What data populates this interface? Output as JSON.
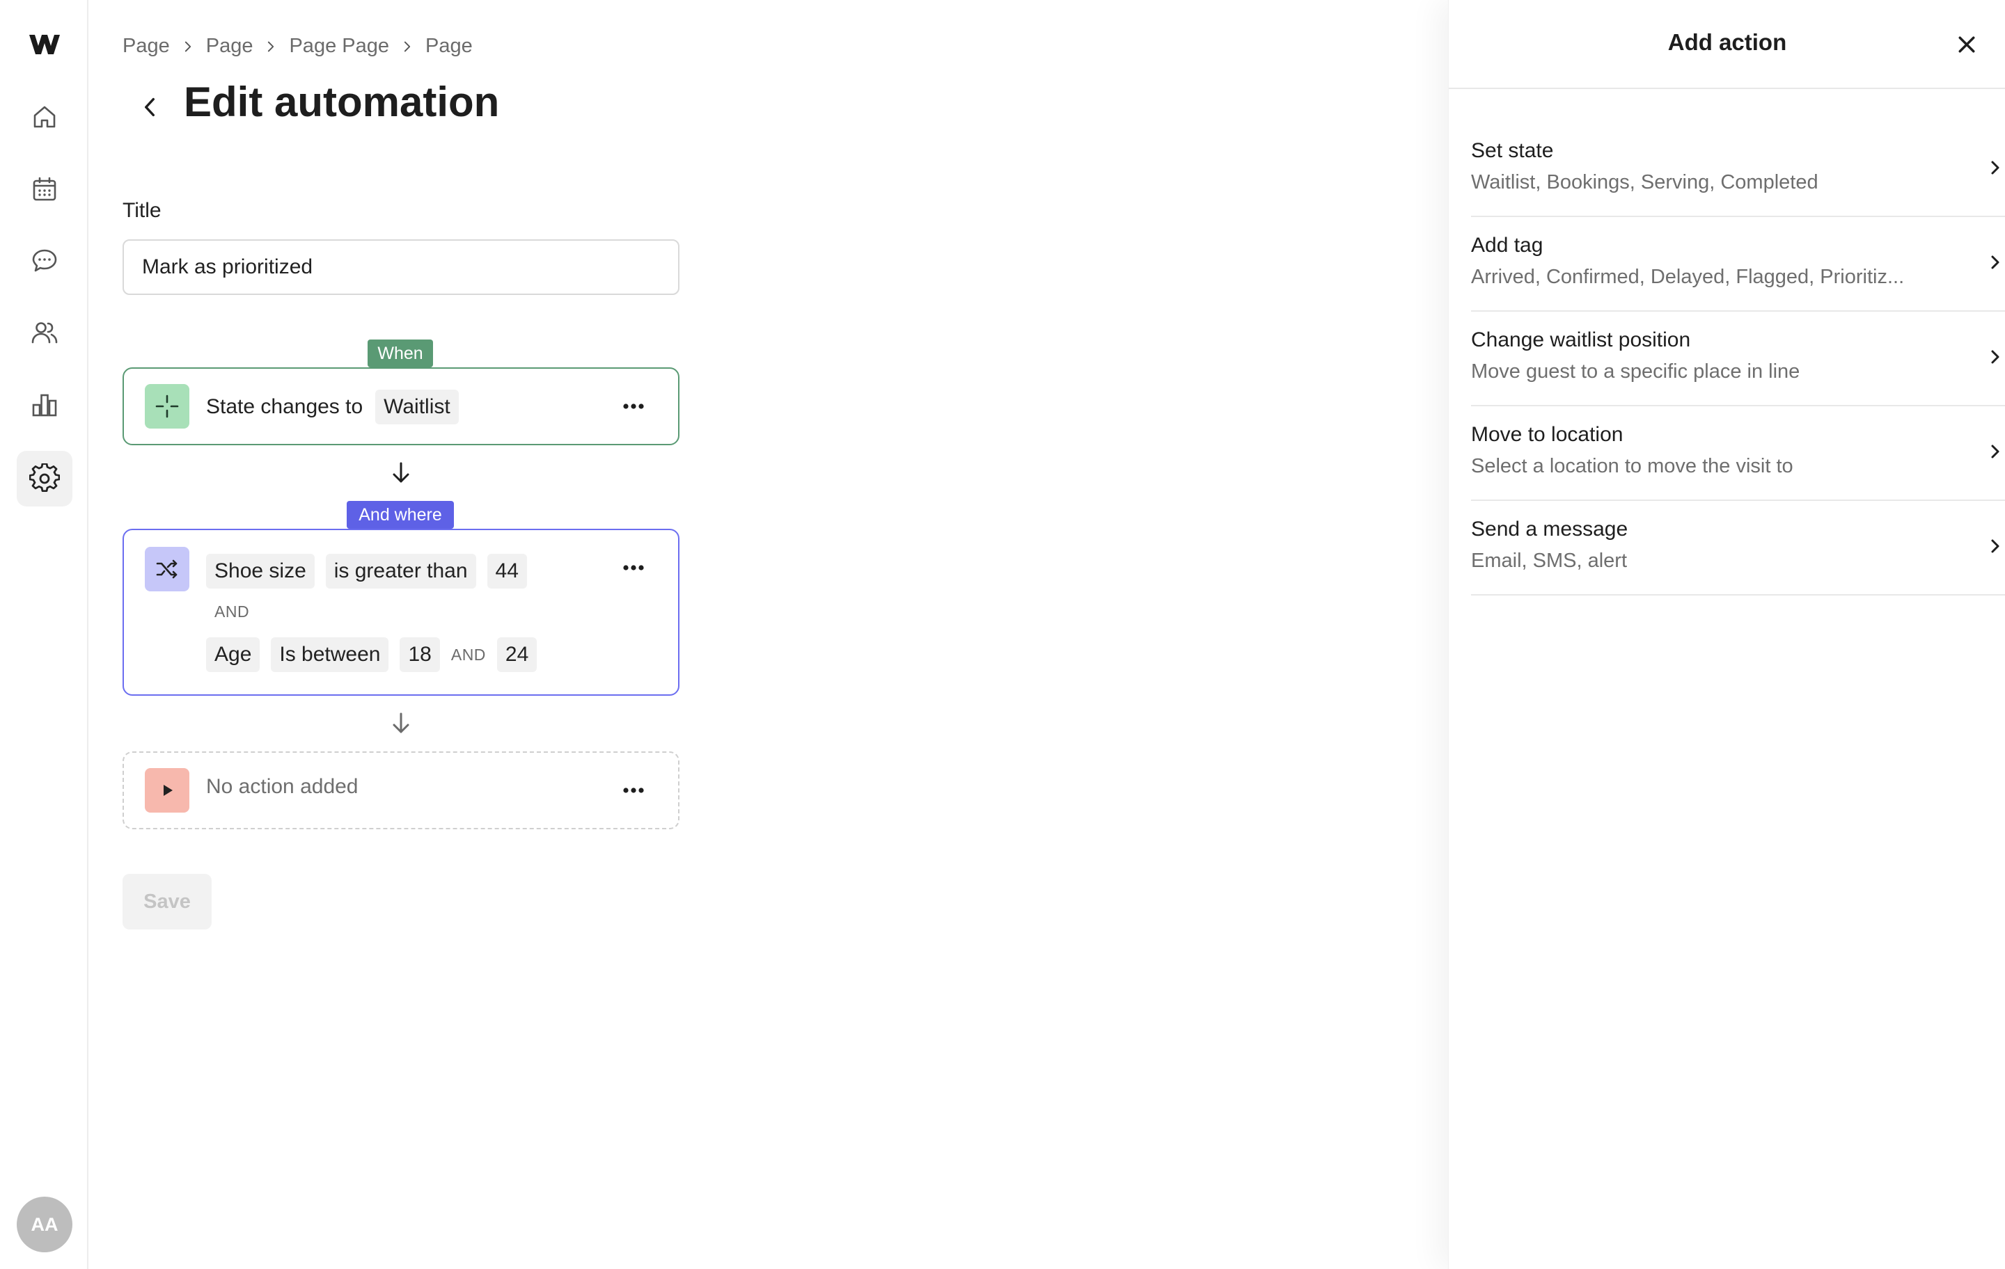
{
  "rail": {
    "logo": "w-logo-icon",
    "items": [
      {
        "name": "home",
        "icon": "home-icon",
        "active": false
      },
      {
        "name": "calendar",
        "icon": "calendar-icon",
        "active": false
      },
      {
        "name": "messages",
        "icon": "chat-icon",
        "active": false
      },
      {
        "name": "guests",
        "icon": "users-icon",
        "active": false
      },
      {
        "name": "analytics",
        "icon": "bar-chart-icon",
        "active": false
      },
      {
        "name": "settings",
        "icon": "gear-icon",
        "active": true
      }
    ],
    "avatar_initials": "AA"
  },
  "breadcrumb": [
    "Page",
    "Page",
    "Page Page",
    "Page"
  ],
  "page": {
    "title": "Edit automation",
    "title_label": "Title",
    "title_value": "Mark as prioritized"
  },
  "trigger": {
    "tag": "When",
    "text": "State changes to",
    "value": "Waitlist"
  },
  "condition": {
    "tag": "And where",
    "row1": {
      "field": "Shoe size",
      "operator": "is greater than",
      "value": "44"
    },
    "joiner": "AND",
    "row2": {
      "field": "Age",
      "operator": "Is between",
      "value_from": "18",
      "between_joiner": "AND",
      "value_to": "24"
    }
  },
  "action": {
    "text": "No action added"
  },
  "save_label": "Save",
  "panel": {
    "title": "Add action",
    "items": [
      {
        "title": "Set state",
        "description": "Waitlist, Bookings, Serving, Completed"
      },
      {
        "title": "Add tag",
        "description": "Arrived, Confirmed, Delayed, Flagged, Prioritiz..."
      },
      {
        "title": "Change waitlist position",
        "description": "Move guest to a specific place in line"
      },
      {
        "title": "Move to location",
        "description": "Select a location to move the visit to"
      },
      {
        "title": "Send a message",
        "description": "Email, SMS, alert"
      }
    ]
  },
  "colors": {
    "when_accent": "#5a9a74",
    "where_accent": "#5e61e6",
    "action_accent": "#f7b8ad"
  }
}
